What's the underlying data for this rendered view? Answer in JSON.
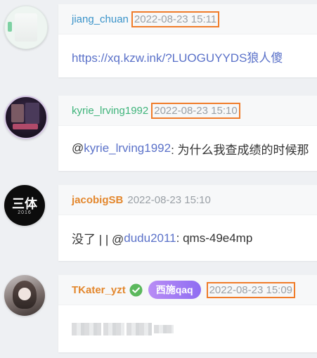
{
  "comments": [
    {
      "username": "jiang_chuan",
      "username_color": "#3a93c9",
      "time": "2022-08-23 15:11",
      "content_link": "https://xq.kzw.ink/?LUOGUYYDS狼人傻"
    },
    {
      "username": "kyrie_lrving1992",
      "username_color": "#3fb47b",
      "time": "2022-08-23 15:10",
      "mention_at": "@",
      "mention": "kyrie_lrving1992",
      "content_text": " : 为什么我查成绩的时候那"
    },
    {
      "username": "jacobigSB",
      "username_color": "#e3872d",
      "time": "2022-08-23 15:10",
      "content_prefix": "没了 | | @",
      "mention": "dudu2011",
      "content_text": " : qms-49e4mp"
    },
    {
      "username": "TKater_yzt",
      "username_color": "#e3872d",
      "verified_icon": "verified-check-icon",
      "badge": "西施qaq",
      "time": "2022-08-23 15:09",
      "content_redacted": true
    }
  ],
  "colors": {
    "highlight_border": "#f07c2a",
    "link": "#5b72c9",
    "timestamp": "#9aa0a6",
    "badge_gradient": [
      "#b98df5",
      "#8f6df2"
    ],
    "verified": "#5bb85d"
  },
  "avatar_texts": {
    "third": "三体",
    "third_year": "2016"
  }
}
